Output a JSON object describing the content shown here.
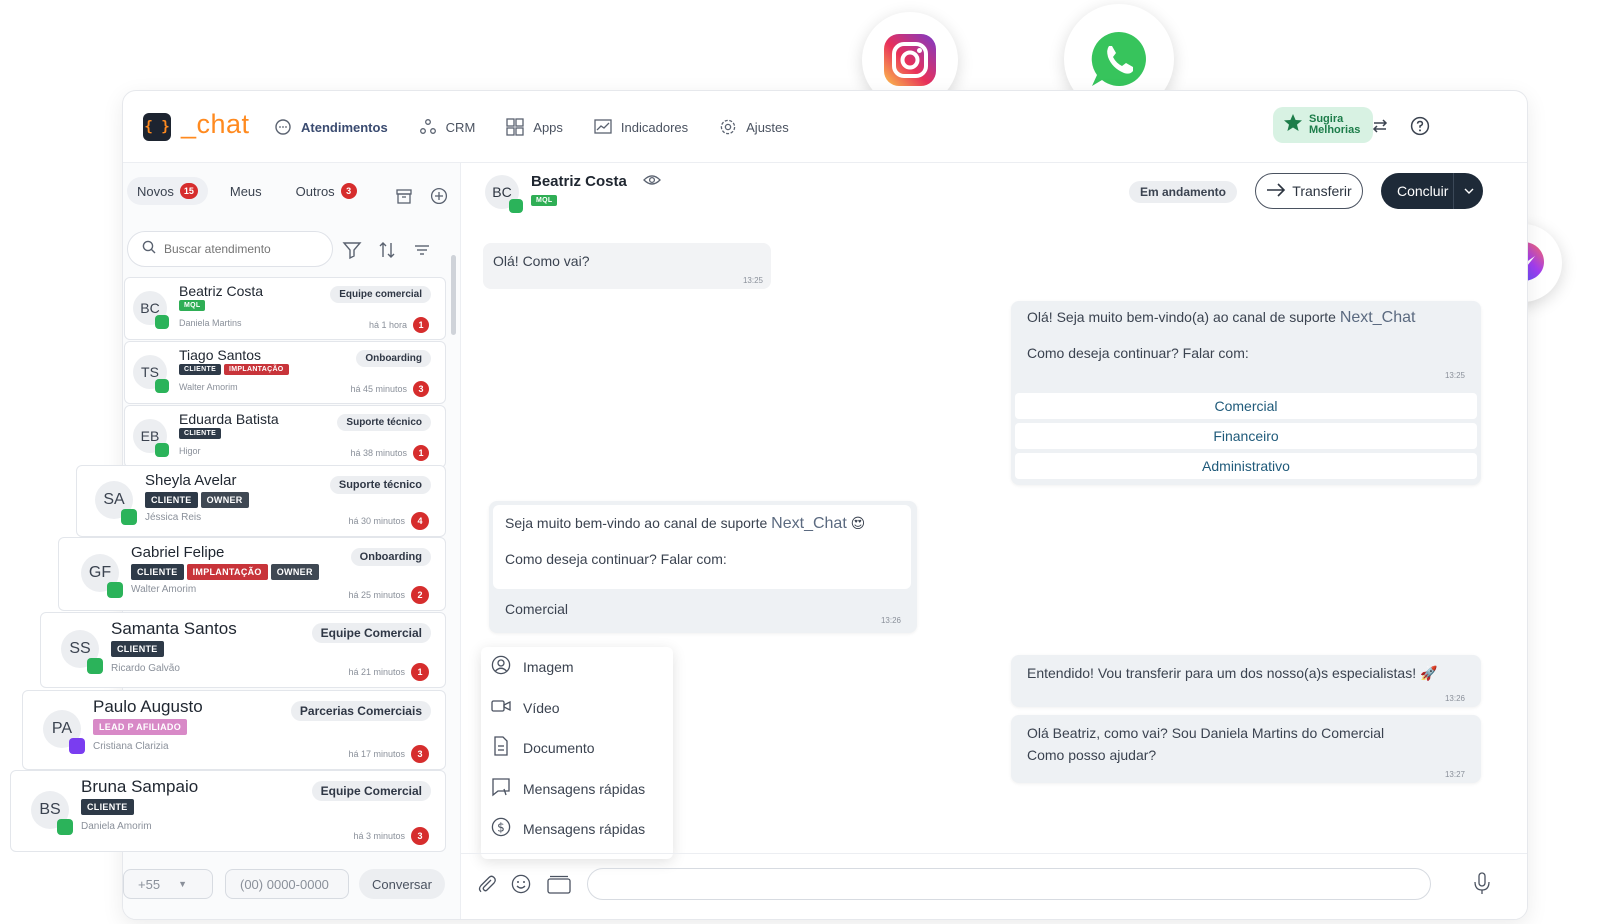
{
  "app": {
    "logo_text": "_chat",
    "logo_mark": "{ }",
    "nav": [
      {
        "label": "Atendimentos",
        "icon": "chat-bubble-icon"
      },
      {
        "label": "CRM",
        "icon": "crm-nodes-icon"
      },
      {
        "label": "Apps",
        "icon": "apps-grid-icon"
      },
      {
        "label": "Indicadores",
        "icon": "chart-icon"
      },
      {
        "label": "Ajustes",
        "icon": "gear-icon"
      }
    ],
    "sugira": "Sugira Melhorias"
  },
  "sidebar": {
    "tabs": [
      {
        "label": "Novos",
        "count": "15"
      },
      {
        "label": "Meus",
        "count": ""
      },
      {
        "label": "Outros",
        "count": "3"
      }
    ],
    "search_placeholder": "Buscar atendimento",
    "cards": [
      {
        "initials": "BC",
        "name": "Beatriz Costa",
        "tags": [
          {
            "t": "MQL",
            "c": "mql"
          }
        ],
        "agent": "Daniela Martins",
        "team": "Equipe comercial",
        "time": "há 1 hora",
        "count": "1"
      },
      {
        "initials": "TS",
        "name": "Tiago Santos",
        "tags": [
          {
            "t": "CLIENTE",
            "c": "cliente"
          },
          {
            "t": "IMPLANTAÇÃO",
            "c": "implantacao"
          }
        ],
        "agent": "Walter Amorim",
        "team": "Onboarding",
        "time": "há 45 minutos",
        "count": "3"
      },
      {
        "initials": "EB",
        "name": "Eduarda Batista",
        "tags": [
          {
            "t": "CLIENTE",
            "c": "cliente"
          }
        ],
        "agent": "Higor",
        "team": "Suporte técnico",
        "time": "há 38 minutos",
        "count": "1"
      },
      {
        "initials": "SA",
        "name": "Sheyla Avelar",
        "tags": [
          {
            "t": "CLIENTE",
            "c": "cliente"
          },
          {
            "t": "OWNER",
            "c": "owner"
          }
        ],
        "agent": "Jéssica Reis",
        "team": "Suporte técnico",
        "time": "há 30 minutos",
        "count": "4"
      },
      {
        "initials": "GF",
        "name": "Gabriel Felipe",
        "tags": [
          {
            "t": "CLIENTE",
            "c": "cliente"
          },
          {
            "t": "IMPLANTAÇÃO",
            "c": "implantacao"
          },
          {
            "t": "OWNER",
            "c": "owner"
          }
        ],
        "agent": "Walter Amorim",
        "team": "Onboarding",
        "time": "há 25 minutos",
        "count": "2"
      },
      {
        "initials": "SS",
        "name": "Samanta Santos",
        "tags": [
          {
            "t": "CLIENTE",
            "c": "cliente"
          }
        ],
        "agent": "Ricardo Galvão",
        "team": "Equipe Comercial",
        "time": "há 21 minutos",
        "count": "1"
      },
      {
        "initials": "PA",
        "name": "Paulo Augusto",
        "tags": [
          {
            "t": "LEAD P AFILIADO",
            "c": "lead"
          }
        ],
        "agent": "Cristiana Clarizia",
        "team": "Parcerias Comerciais",
        "time": "há 17 minutos",
        "count": "3"
      },
      {
        "initials": "BS",
        "name": "Bruna Sampaio",
        "tags": [
          {
            "t": "CLIENTE",
            "c": "cliente"
          }
        ],
        "agent": "Daniela Amorim",
        "team": "Equipe Comercial",
        "time": "há 3 minutos",
        "count": "3"
      }
    ],
    "phone": {
      "ddi": "+55",
      "placeholder": "(00) 0000-0000",
      "button": "Conversar"
    }
  },
  "chat": {
    "contact": {
      "initials": "BC",
      "name": "Beatriz Costa",
      "tag": "MQL"
    },
    "status": "Em andamento",
    "transfer": "Transferir",
    "conclude": "Concluir",
    "messages": {
      "m1": {
        "text": "Olá! Como vai?",
        "time": "13:25"
      },
      "m2": {
        "text_a": "Olá! Seja muito bem-vindo(a) ao canal de suporte",
        "brand": "Next_Chat",
        "text_b": "Como deseja continuar? Falar com:",
        "time": "13:25",
        "options": [
          "Comercial",
          "Financeiro",
          "Administrativo"
        ]
      },
      "m3": {
        "text_a": "Seja muito bem-vindo ao canal de suporte",
        "brand": "Next_Chat",
        "emoji": "😍",
        "text_b": "Como deseja continuar? Falar com:",
        "reply": "Comercial",
        "time": "13:26"
      },
      "m4": {
        "text": "Entendido! Vou transferir para um dos nosso(a)s especialistas! 🚀",
        "time": "13:26"
      },
      "m5": {
        "line1": "Olá Beatriz, como vai? Sou Daniela Martins do Comercial",
        "line2": "Como posso ajudar?",
        "time": "13:27"
      }
    },
    "attach_menu": [
      {
        "label": "Imagem",
        "icon": "image-icon"
      },
      {
        "label": "Vídeo",
        "icon": "video-icon"
      },
      {
        "label": "Documento",
        "icon": "document-icon"
      },
      {
        "label": "Mensagens rápidas",
        "icon": "quick-message-icon"
      },
      {
        "label": "Mensagens rápidas",
        "icon": "dollar-icon"
      }
    ]
  },
  "colors": {
    "brand_orange": "#ff8a1f",
    "dark": "#1d2430",
    "whatsapp": "#2bb35a",
    "red": "#d62d2d"
  }
}
